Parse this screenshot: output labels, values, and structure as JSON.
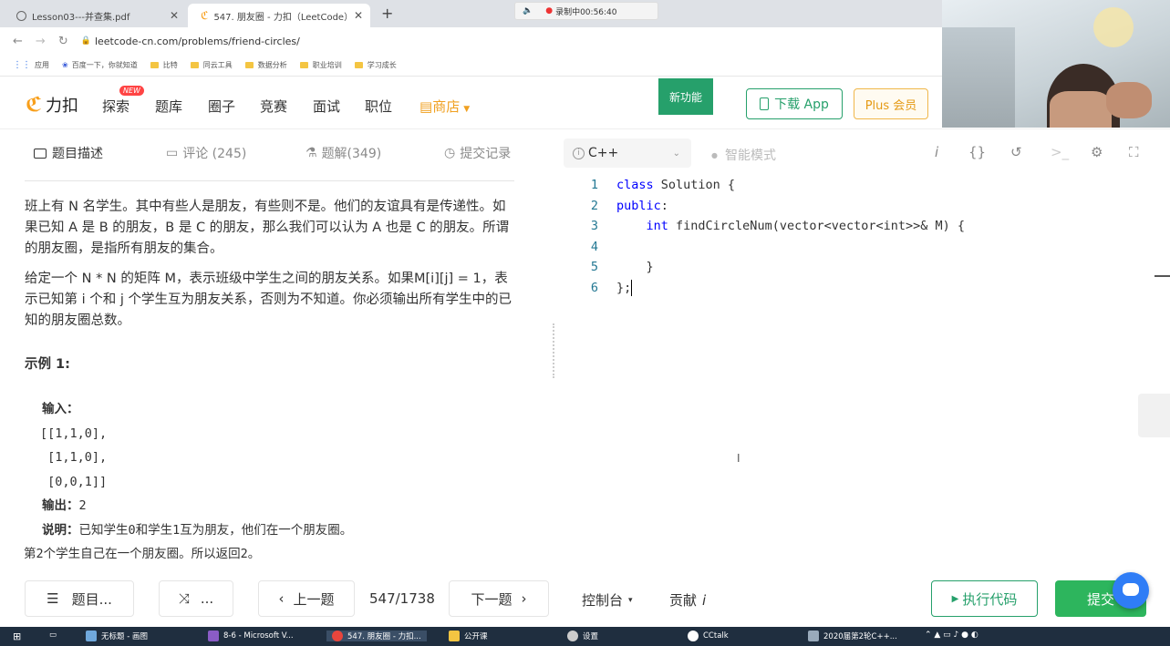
{
  "browser": {
    "tabs": [
      {
        "title": "Lesson03---并查集.pdf",
        "active": false
      },
      {
        "title": "547. 朋友圈 - 力扣（LeetCode）",
        "active": true
      }
    ],
    "recording": "录制中00:56:40",
    "url": "leetcode-cn.com/problems/friend-circles/",
    "bookmarks": [
      "应用",
      "百度一下，你就知道",
      "比特",
      "同云工具",
      "数据分析",
      "职业培训",
      "学习成长"
    ]
  },
  "header": {
    "logo": "力扣",
    "nav": [
      "探索",
      "题库",
      "圈子",
      "竞赛",
      "面试",
      "职位"
    ],
    "new_badge": "NEW",
    "store": "商店",
    "new_feature": "新功能",
    "download_app": "下载 App",
    "plus": "Plus 会员"
  },
  "left_tabs": [
    {
      "label": "题目描述",
      "active": true
    },
    {
      "label": "评论 (245)",
      "active": false
    },
    {
      "label": "题解(349)",
      "active": false
    },
    {
      "label": "提交记录",
      "active": false
    }
  ],
  "description": {
    "p1": "班上有 N 名学生。其中有些人是朋友，有些则不是。他们的友谊具有是传递性。如果已知 A 是 B 的朋友，B 是 C 的朋友，那么我们可以认为 A 也是 C 的朋友。所谓的朋友圈，是指所有朋友的集合。",
    "p2": "给定一个 N * N 的矩阵 M，表示班级中学生之间的朋友关系。如果M[i][j] = 1，表示已知第 i 个和 j 个学生互为朋友关系，否则为不知道。你必须输出所有学生中的已知的朋友圈总数。",
    "example_title": "示例 1:",
    "example": {
      "input_label": "输入：",
      "input_lines": [
        "[[1,1,0],",
        " [1,1,0],",
        " [0,0,1]]"
      ],
      "output_label": "输出：",
      "output_value": "2",
      "explain_label": "说明：",
      "explain_text": "已知学生0和学生1互为朋友，他们在一个朋友圈。",
      "explain_text2": "第2个学生自己在一个朋友圈。所以返回2。"
    }
  },
  "editor": {
    "language": "C++",
    "smart_mode": "智能模式",
    "lines": [
      {
        "n": "1",
        "kw": "class",
        "rest": " Solution {"
      },
      {
        "n": "2",
        "kw": "public",
        "rest": ":"
      },
      {
        "n": "3",
        "kw": "    int",
        "rest": " findCircleNum(vector<vector<int>>& M) {"
      },
      {
        "n": "4",
        "kw": "",
        "rest": ""
      },
      {
        "n": "5",
        "kw": "",
        "rest": "    }"
      },
      {
        "n": "6",
        "kw": "",
        "rest": "};"
      }
    ]
  },
  "bottom": {
    "list": "题目...",
    "random": "...",
    "prev": "上一题",
    "counter": "547/1738",
    "next": "下一题",
    "console": "控制台",
    "contribute": "贡献",
    "run": "执行代码",
    "submit": "提交"
  },
  "taskbar": {
    "items": [
      "无标题 - 画图",
      "8-6 - Microsoft V...",
      "547. 朋友圈 - 力扣...",
      "公开课",
      "设置",
      "CCtalk",
      "2020届第2轮C++..."
    ]
  }
}
